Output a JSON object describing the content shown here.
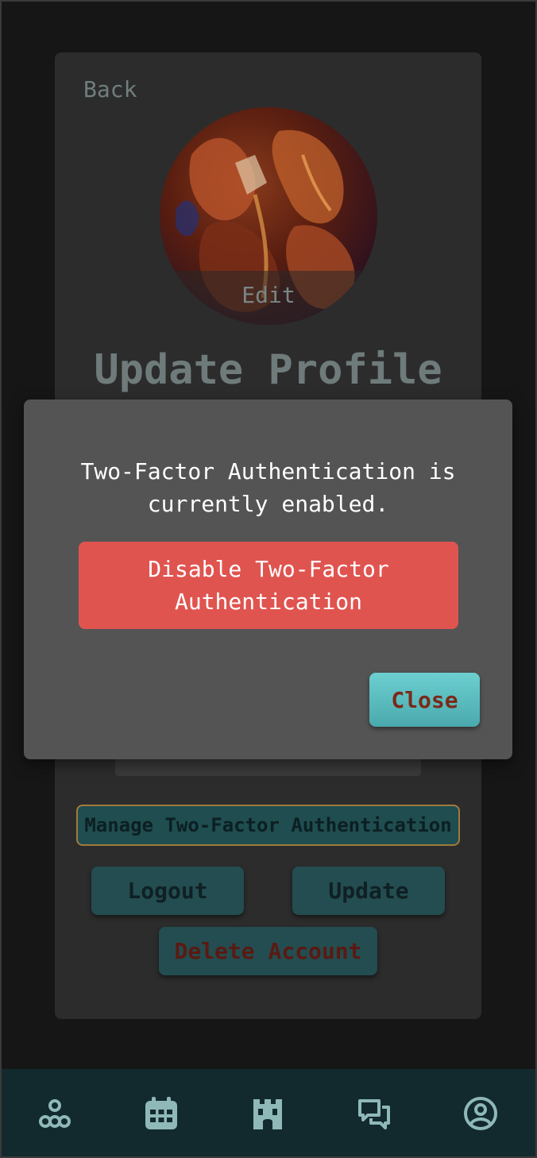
{
  "header": {
    "back_label": "Back"
  },
  "avatar": {
    "edit_label": "Edit"
  },
  "page": {
    "title": "Update Profile"
  },
  "actions": {
    "manage_2fa_label": "Manage Two-Factor Authentication",
    "logout_label": "Logout",
    "update_label": "Update",
    "delete_label": "Delete Account"
  },
  "modal": {
    "message": "Two-Factor Authentication is currently enabled.",
    "disable_label": "Disable Two-Factor Authentication",
    "close_label": "Close"
  },
  "bottom_nav": {
    "items": [
      {
        "icon": "nodes-icon"
      },
      {
        "icon": "calendar-icon"
      },
      {
        "icon": "castle-icon"
      },
      {
        "icon": "chat-icon"
      },
      {
        "icon": "user-circle-icon"
      }
    ]
  },
  "colors": {
    "background": "#161616",
    "card": "#2c2c2c",
    "modal": "#545454",
    "danger": "#e05450",
    "accent_teal": "#5cbfc2",
    "button_teal": "#234d50",
    "nav_bar": "#122a2e",
    "nav_icon": "#8fb8b9"
  }
}
